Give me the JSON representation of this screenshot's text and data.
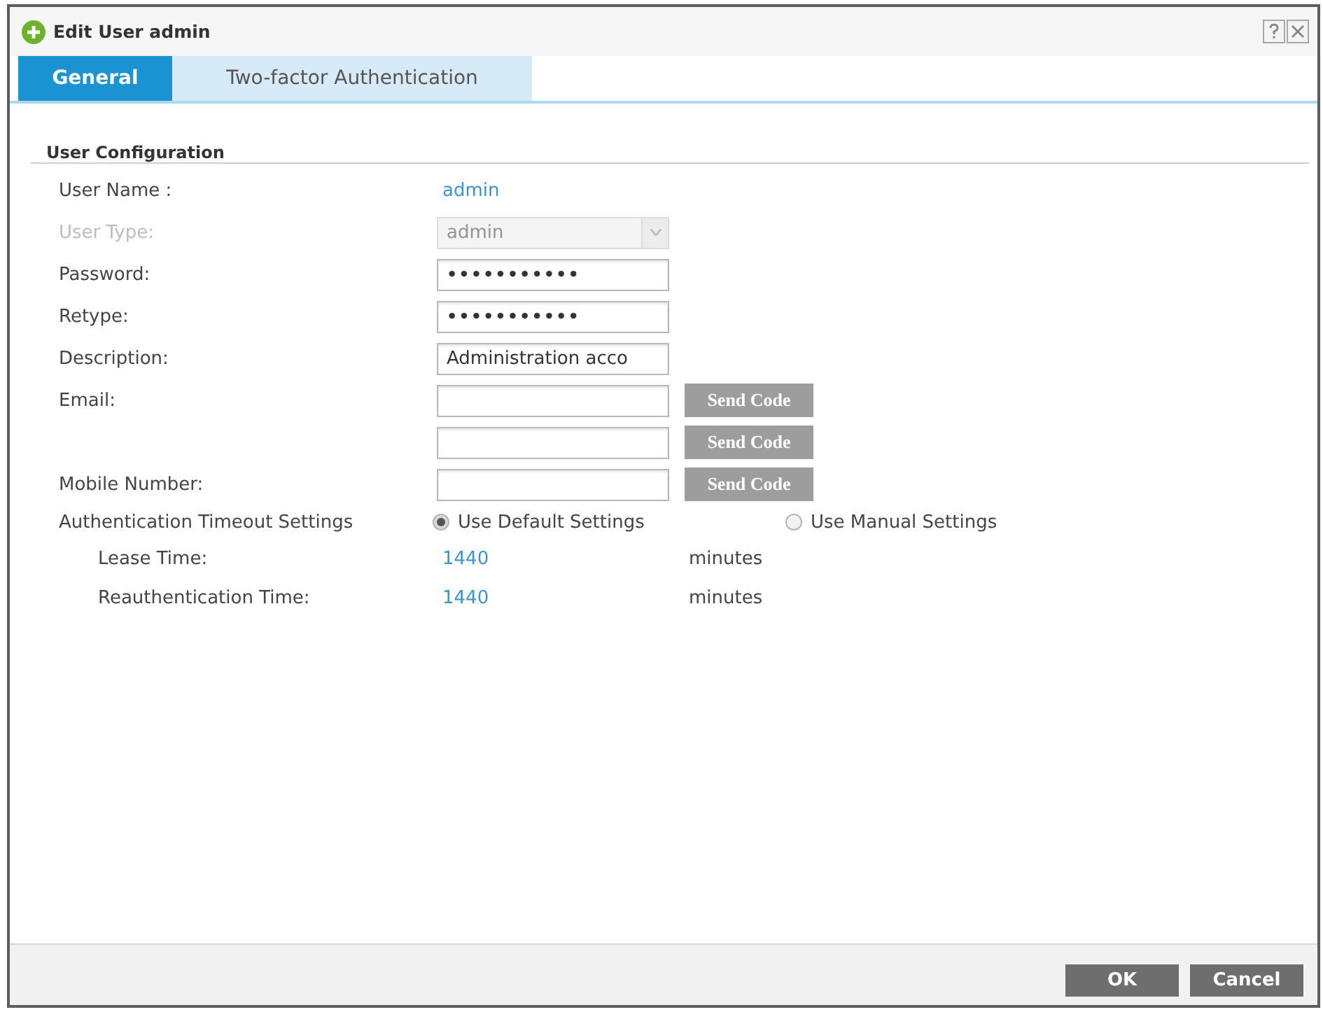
{
  "window": {
    "title": "Edit User admin"
  },
  "tabs": [
    {
      "label": "General",
      "selected": true
    },
    {
      "label": "Two-factor Authentication",
      "selected": false
    }
  ],
  "section": {
    "title": "User Configuration"
  },
  "fields": [
    {
      "kind": "text",
      "label": "User Name :",
      "value": "admin",
      "disabled": false
    },
    {
      "kind": "select",
      "label": "User Type:",
      "value": "admin",
      "disabled": true
    },
    {
      "kind": "password",
      "label": "Password:",
      "value": "•••••••••••",
      "disabled": false
    },
    {
      "kind": "password",
      "label": "Retype:",
      "value": "•••••••••••",
      "disabled": false
    },
    {
      "kind": "input",
      "label": "Description:",
      "value": "Administration acco",
      "disabled": false
    },
    {
      "kind": "input_button",
      "label": "Email:",
      "disabled": false,
      "button": {
        "label": "Send Code",
        "disabled": true
      }
    },
    {
      "kind": "input_button",
      "disabled": false,
      "button": {
        "label": "Send Code",
        "disabled": true
      }
    },
    {
      "kind": "input_button",
      "label": "Mobile Number:",
      "disabled": false,
      "button": {
        "label": "Send Code",
        "disabled": true
      }
    },
    {
      "kind": "radio",
      "label": "Authentication Timeout Settings",
      "disabled": false,
      "options": [
        {
          "label": "Use Default Settings",
          "selected": true
        },
        {
          "label": "Use Manual Settings",
          "selected": false
        }
      ],
      "children": [
        {
          "kind": "reading",
          "label": "Lease Time:",
          "value": "1440",
          "unit": "minutes",
          "disabled": false
        },
        {
          "kind": "reading",
          "label": "Reauthentication Time:",
          "value": "1440",
          "unit": "minutes",
          "disabled": false
        }
      ]
    }
  ],
  "buttons": [
    {
      "label": "OK"
    },
    {
      "label": "Cancel"
    }
  ]
}
